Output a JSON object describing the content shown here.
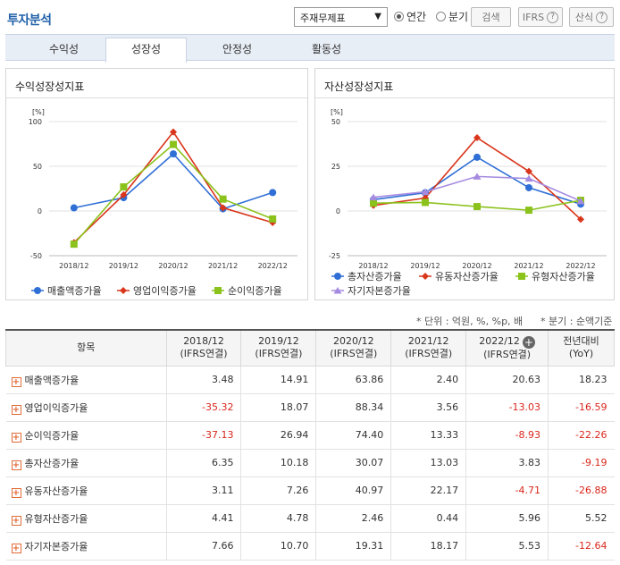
{
  "header": {
    "title": "투자분석",
    "select_value": "주재무제표",
    "radio_annual": "연간",
    "radio_quarter": "분기",
    "search_label": "검색",
    "ifrs_label": "IFRS",
    "formula_label": "산식"
  },
  "tabs": [
    "수익성",
    "성장성",
    "안정성",
    "활동성"
  ],
  "charts": {
    "left_title": "수익성장성지표",
    "right_title": "자산성장성지표",
    "unit": "[%]"
  },
  "colors": {
    "blue": "#2f6fd6",
    "red": "#d9361c",
    "green": "#8bc21c",
    "purple": "#a58be0"
  },
  "chart_data": [
    {
      "type": "line",
      "title": "수익성장성지표",
      "categories": [
        "2018/12",
        "2019/12",
        "2020/12",
        "2021/12",
        "2022/12"
      ],
      "ylim": [
        -50,
        100
      ],
      "yticks": [
        100,
        50,
        0,
        -50
      ],
      "legend_position": "bottom",
      "series": [
        {
          "name": "매출액증가율",
          "values": [
            3.48,
            14.91,
            63.86,
            2.4,
            20.63
          ],
          "color": "#2f6fd6",
          "marker": "circle"
        },
        {
          "name": "영업이익증가율",
          "values": [
            -35.32,
            18.07,
            88.34,
            3.56,
            -13.03
          ],
          "color": "#d9361c",
          "marker": "diamond"
        },
        {
          "name": "순이익증가율",
          "values": [
            -37.13,
            26.94,
            74.4,
            13.33,
            -8.93
          ],
          "color": "#8bc21c",
          "marker": "square"
        }
      ]
    },
    {
      "type": "line",
      "title": "자산성장성지표",
      "categories": [
        "2018/12",
        "2019/12",
        "2020/12",
        "2021/12",
        "2022/12"
      ],
      "ylim": [
        -25,
        50
      ],
      "yticks": [
        50,
        25,
        0,
        -25
      ],
      "legend_position": "bottom",
      "series": [
        {
          "name": "총자산증가율",
          "values": [
            6.35,
            10.18,
            30.07,
            13.03,
            3.83
          ],
          "color": "#2f6fd6",
          "marker": "circle"
        },
        {
          "name": "유동자산증가율",
          "values": [
            3.11,
            7.26,
            40.97,
            22.17,
            -4.71
          ],
          "color": "#d9361c",
          "marker": "diamond"
        },
        {
          "name": "유형자산증가율",
          "values": [
            4.41,
            4.78,
            2.46,
            0.44,
            5.96
          ],
          "color": "#8bc21c",
          "marker": "square"
        },
        {
          "name": "자기자본증가율",
          "values": [
            7.66,
            10.7,
            19.31,
            18.17,
            5.53
          ],
          "color": "#a58be0",
          "marker": "triangle"
        }
      ]
    }
  ],
  "notes": {
    "unit": "* 단위 : 억원, %, %p, 배",
    "quarter": "* 분기 : 순액기준"
  },
  "table": {
    "headers": [
      "항목",
      "2018/12",
      "2019/12",
      "2020/12",
      "2021/12",
      "2022/12",
      "전년대비"
    ],
    "subheaders": [
      "",
      "(IFRS연결)",
      "(IFRS연결)",
      "(IFRS연결)",
      "(IFRS연결)",
      "(IFRS연결)",
      "(YoY)"
    ],
    "rows": [
      {
        "name": "매출액증가율",
        "values": [
          "3.48",
          "14.91",
          "63.86",
          "2.40",
          "20.63",
          "18.23"
        ]
      },
      {
        "name": "영업이익증가율",
        "values": [
          "-35.32",
          "18.07",
          "88.34",
          "3.56",
          "-13.03",
          "-16.59"
        ]
      },
      {
        "name": "순이익증가율",
        "values": [
          "-37.13",
          "26.94",
          "74.40",
          "13.33",
          "-8.93",
          "-22.26"
        ]
      },
      {
        "name": "총자산증가율",
        "values": [
          "6.35",
          "10.18",
          "30.07",
          "13.03",
          "3.83",
          "-9.19"
        ]
      },
      {
        "name": "유동자산증가율",
        "values": [
          "3.11",
          "7.26",
          "40.97",
          "22.17",
          "-4.71",
          "-26.88"
        ]
      },
      {
        "name": "유형자산증가율",
        "values": [
          "4.41",
          "4.78",
          "2.46",
          "0.44",
          "5.96",
          "5.52"
        ]
      },
      {
        "name": "자기자본증가율",
        "values": [
          "7.66",
          "10.70",
          "19.31",
          "18.17",
          "5.53",
          "-12.64"
        ]
      }
    ]
  }
}
